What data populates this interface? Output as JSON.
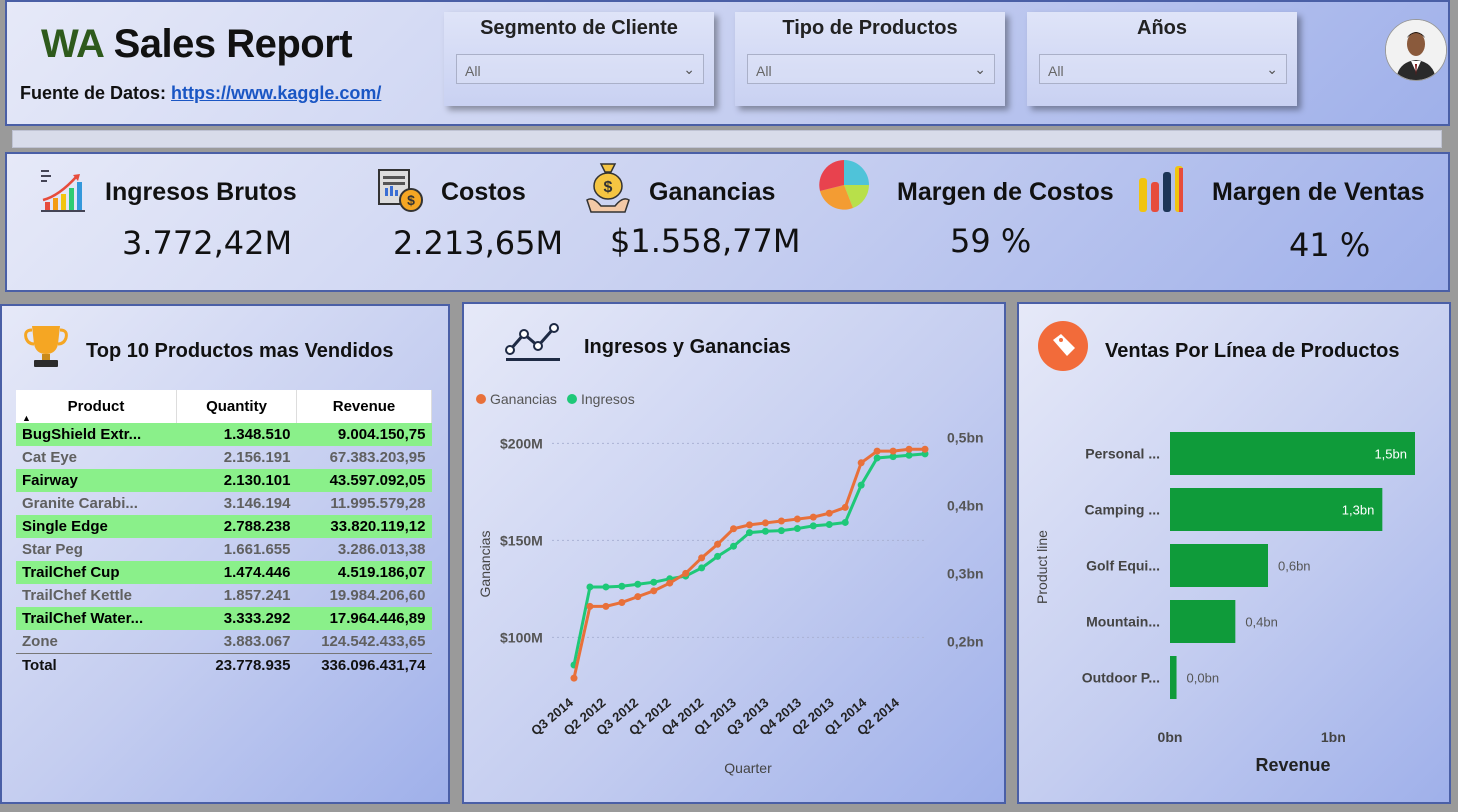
{
  "header": {
    "title_wa": "WA",
    "title_rest": " Sales Report",
    "source_label": "Fuente de Datos:",
    "source_link": "https://www.kaggle.com/"
  },
  "slicers": [
    {
      "label": "Segmento de Cliente",
      "value": "All"
    },
    {
      "label": "Tipo de Productos",
      "value": "All"
    },
    {
      "label": "Años",
      "value": "All"
    }
  ],
  "kpis": [
    {
      "label": "Ingresos Brutos",
      "value": "3.772,42M"
    },
    {
      "label": "Costos",
      "value": "2.213,65M"
    },
    {
      "label": "Ganancias",
      "value": "$1.558,77M"
    },
    {
      "label": "Margen de Costos",
      "value": "59 %"
    },
    {
      "label": "Margen de Ventas",
      "value": "41 %"
    }
  ],
  "top10": {
    "title": "Top 10  Productos mas Vendidos",
    "columns": [
      "Product",
      "Quantity",
      "Revenue"
    ],
    "rows": [
      {
        "product": "BugShield Extr...",
        "quantity": "1.348.510",
        "revenue": "9.004.150,75",
        "highlight": true
      },
      {
        "product": "Cat Eye",
        "quantity": "2.156.191",
        "revenue": "67.383.203,95",
        "highlight": false
      },
      {
        "product": "Fairway",
        "quantity": "2.130.101",
        "revenue": "43.597.092,05",
        "highlight": true
      },
      {
        "product": "Granite Carabi...",
        "quantity": "3.146.194",
        "revenue": "11.995.579,28",
        "highlight": false
      },
      {
        "product": "Single Edge",
        "quantity": "2.788.238",
        "revenue": "33.820.119,12",
        "highlight": true
      },
      {
        "product": "Star Peg",
        "quantity": "1.661.655",
        "revenue": "3.286.013,38",
        "highlight": false
      },
      {
        "product": "TrailChef Cup",
        "quantity": "1.474.446",
        "revenue": "4.519.186,07",
        "highlight": true
      },
      {
        "product": "TrailChef Kettle",
        "quantity": "1.857.241",
        "revenue": "19.984.206,60",
        "highlight": false
      },
      {
        "product": "TrailChef Water...",
        "quantity": "3.333.292",
        "revenue": "17.964.446,89",
        "highlight": true
      },
      {
        "product": "Zone",
        "quantity": "3.883.067",
        "revenue": "124.542.433,65",
        "highlight": false
      }
    ],
    "total": {
      "label": "Total",
      "quantity": "23.778.935",
      "revenue": "336.096.431,74"
    }
  },
  "line_panel": {
    "title": "Ingresos y Ganancias"
  },
  "bar_panel": {
    "title": "Ventas Por Línea de Productos"
  },
  "colors": {
    "ganancias": "#e8703a",
    "ingresos": "#1ec878",
    "bar": "#0f9b3a",
    "highlight_row": "#8af08a"
  },
  "chart_data": [
    {
      "type": "line",
      "legend": [
        "Ganancias",
        "Ingresos"
      ],
      "legend_position": "top-left",
      "xlabel": "Quarter",
      "ylabel": "Ganancias",
      "quarters": [
        "Q3 2014",
        "Q2 2012",
        "Q3 2012",
        "Q1 2012",
        "Q4 2012",
        "Q1 2013",
        "Q3 2013",
        "Q4 2013",
        "Q2 2013",
        "Q1 2014",
        "Q2 2014"
      ],
      "y_left_ticks": [
        "$200M",
        "$150M",
        "$100M"
      ],
      "y_left_range": [
        77,
        210
      ],
      "y_right_ticks": [
        "0,5bn",
        "0,4bn",
        "0,3bn",
        "0,2bn"
      ],
      "y_right_range": [
        0.14,
        0.52
      ],
      "series": [
        {
          "name": "Ganancias",
          "axis": "left",
          "values": [
            79,
            116,
            116,
            118,
            121,
            124,
            128,
            133,
            141,
            148,
            156,
            158,
            159,
            160,
            161,
            162,
            164,
            167,
            190,
            196,
            196,
            197,
            197
          ]
        },
        {
          "name": "Ingresos",
          "axis": "right",
          "values": [
            0.165,
            0.28,
            0.28,
            0.281,
            0.284,
            0.287,
            0.292,
            0.296,
            0.308,
            0.325,
            0.34,
            0.36,
            0.362,
            0.363,
            0.366,
            0.37,
            0.372,
            0.375,
            0.43,
            0.47,
            0.472,
            0.474,
            0.476
          ]
        }
      ]
    },
    {
      "type": "bar",
      "orientation": "horizontal",
      "xlabel": "Revenue",
      "ylabel": "Product line",
      "x_ticks": [
        "0bn",
        "1bn"
      ],
      "xlim": [
        0,
        1.5
      ],
      "categories": [
        "Personal ...",
        "Camping ...",
        "Golf Equi...",
        "Mountain...",
        "Outdoor P..."
      ],
      "values": [
        1.5,
        1.3,
        0.6,
        0.4,
        0.04
      ],
      "value_labels": [
        "1,5bn",
        "1,3bn",
        "0,6bn",
        "0,4bn",
        "0,0bn"
      ]
    }
  ]
}
